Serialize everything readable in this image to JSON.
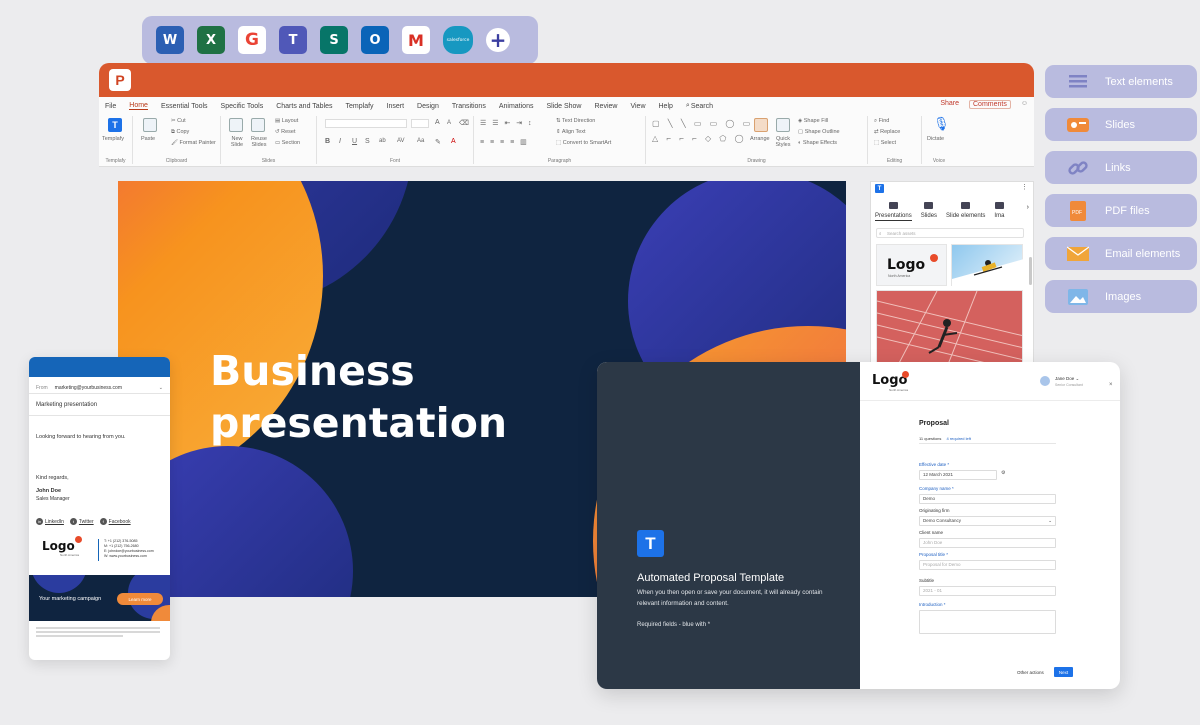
{
  "launcher": {
    "apps": [
      {
        "name": "word",
        "letter": "W",
        "color": "#2b5fb3"
      },
      {
        "name": "excel",
        "letter": "X",
        "color": "#1f7144"
      },
      {
        "name": "google",
        "letter": "G",
        "color": "#ea4335"
      },
      {
        "name": "teams",
        "letter": "T",
        "color": "#5058b8"
      },
      {
        "name": "sharepoint",
        "letter": "S",
        "color": "#077568"
      },
      {
        "name": "outlook",
        "letter": "O",
        "color": "#0a64b8"
      },
      {
        "name": "gmail",
        "letter": "M",
        "color": "#d93025"
      },
      {
        "name": "salesforce",
        "letter": "salesforce",
        "color": "#1798c1"
      }
    ],
    "plus": "+"
  },
  "ppt": {
    "logo": "P",
    "tabs": [
      "File",
      "Home",
      "Essential Tools",
      "Specific Tools",
      "Charts and Tables",
      "Templafy",
      "Insert",
      "Design",
      "Transitions",
      "Animations",
      "Slide Show",
      "Review",
      "View",
      "Help",
      "Search"
    ],
    "active_tab": "Home",
    "share": "Share",
    "comments": "Comments",
    "groups": {
      "templafy": {
        "label": "Templafy",
        "button": "Templafy"
      },
      "clipboard": {
        "label": "Clipboard",
        "paste": "Paste",
        "cut": "Cut",
        "copy": "Copy",
        "format_painter": "Format Painter"
      },
      "slides": {
        "label": "Slides",
        "new_slide": "New Slide",
        "reuse": "Reuse Slides",
        "layout": "Layout",
        "reset": "Reset",
        "section": "Section"
      },
      "font": {
        "label": "Font",
        "bold": "B",
        "italic": "I",
        "underline": "U",
        "strike": "S",
        "ab": "ab",
        "av": "AV",
        "aa": "Aa",
        "inc": "A",
        "dec": "A"
      },
      "paragraph": {
        "label": "Paragraph",
        "text_direction": "Text Direction",
        "align_text": "Align Text",
        "smartart": "Convert to SmartArt"
      },
      "drawing": {
        "label": "Drawing",
        "arrange": "Arrange",
        "quick_styles": "Quick Styles",
        "fill": "Shape Fill",
        "outline": "Shape Outline",
        "effects": "Shape Effects"
      },
      "editing": {
        "label": "Editing",
        "find": "Find",
        "replace": "Replace",
        "select": "Select"
      },
      "voice": {
        "label": "Voice",
        "dictate": "Dictate"
      }
    }
  },
  "slide": {
    "title_line1": "Business",
    "title_line2": "presentation"
  },
  "panel": {
    "logo": "T",
    "tabs": [
      "Presentations",
      "Slides",
      "Slide elements",
      "Ima"
    ],
    "active": "Presentations",
    "search_placeholder": "Search assets",
    "thumb_logo": "Logo",
    "thumb_logo_sub": "North America"
  },
  "pills": [
    {
      "label": "Text elements",
      "icon": "text-lines-icon"
    },
    {
      "label": "Slides",
      "icon": "slides-icon"
    },
    {
      "label": "Links",
      "icon": "link-icon"
    },
    {
      "label": "PDF files",
      "icon": "pdf-icon"
    },
    {
      "label": "Email elements",
      "icon": "envelope-icon"
    },
    {
      "label": "Images",
      "icon": "image-icon"
    }
  ],
  "email": {
    "from_label": "From",
    "from_value": "marketing@yourbusiness.com",
    "subject": "Marketing presentation",
    "body": "Looking forward to hearing from you.",
    "regards": "Kind regards,",
    "name": "John Doe",
    "role": "Sales Manager",
    "social": [
      "LinkedIn",
      "Twitter",
      "Facebook"
    ],
    "logo": "Logo",
    "logo_sub": "North America",
    "contacts": [
      "T:  +1 (212) 376-5085",
      "M:  +1 (212) 756-2680",
      "E:  johndoe@yourbusiness.com",
      "W:  www.yourbusiness.com"
    ],
    "banner_text": "Your marketing campaign",
    "banner_button": "Learn more"
  },
  "form": {
    "title": "Automated Proposal Template",
    "desc": "When you then open or save your document, it will already contain relevant information and content.",
    "required": "Required fields - blue with *",
    "logo": "Logo",
    "logo_sub": "North America",
    "user_name": "Jane Doe",
    "user_role": "Senior Consultant",
    "heading": "Proposal",
    "questions": "11 questions",
    "required_left": "4 required left",
    "fields": [
      {
        "label": "Effective date *",
        "value": "12 March 2021",
        "blue": true,
        "placeholder": false
      },
      {
        "label": "Company name *",
        "value": "Demo",
        "blue": true,
        "placeholder": false
      },
      {
        "label": "Originating firm",
        "value": "Demo Consultancy",
        "blue": false,
        "placeholder": false
      },
      {
        "label": "Client name",
        "value": "John Doe",
        "blue": false,
        "placeholder": true
      },
      {
        "label": "Proposal title *",
        "value": "Proposal for Demo",
        "blue": true,
        "placeholder": true
      },
      {
        "label": "Subtitle",
        "value": "2021 - 01",
        "blue": false,
        "placeholder": true
      },
      {
        "label": "Introduction *",
        "value": "",
        "blue": true,
        "placeholder": false
      }
    ],
    "other_actions": "Other actions",
    "next": "Next"
  }
}
